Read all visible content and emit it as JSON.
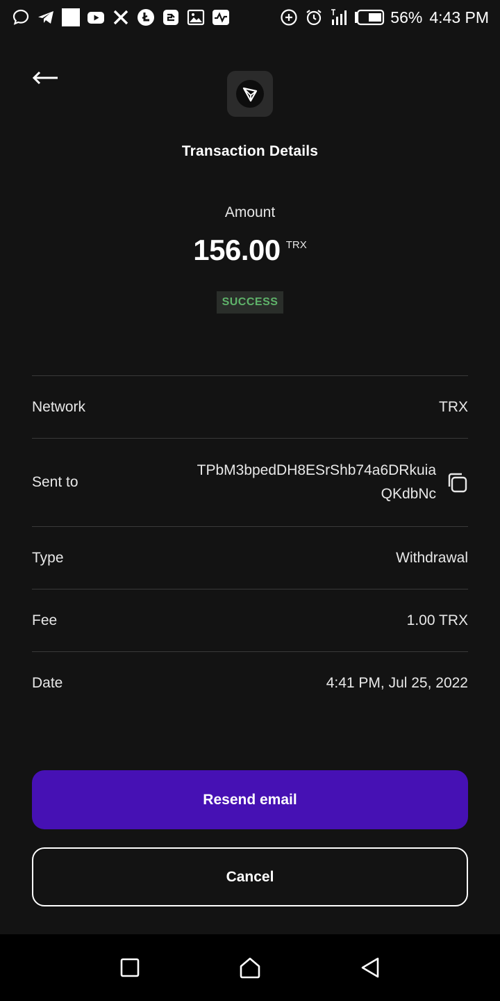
{
  "status_bar": {
    "battery_percent": "56%",
    "time": "4:43 PM",
    "notification_icons": [
      "chat-bubble-icon",
      "telegram-icon",
      "blank-square-icon",
      "youtube-icon",
      "x-icon",
      "litecoin-icon",
      "app-icon",
      "gallery-icon",
      "activity-icon"
    ],
    "system_icons": [
      "data-saver-icon",
      "alarm-icon",
      "signal-icon",
      "battery-icon"
    ]
  },
  "header": {
    "back_icon": "arrow-left-icon",
    "coin_icon": "tron-icon",
    "title": "Transaction Details"
  },
  "amount": {
    "label": "Amount",
    "value": "156.00",
    "unit": "TRX",
    "status": "SUCCESS",
    "status_color": "#5fb36a"
  },
  "details": {
    "network": {
      "label": "Network",
      "value": "TRX"
    },
    "sent_to": {
      "label": "Sent to",
      "value": "TPbM3bpedDH8ESrShb74a6DRkuiaQKdbNc",
      "copy_icon": "copy-icon"
    },
    "type": {
      "label": "Type",
      "value": "Withdrawal"
    },
    "fee": {
      "label": "Fee",
      "value": "1.00 TRX"
    },
    "date": {
      "label": "Date",
      "value": "4:41 PM, Jul 25, 2022"
    }
  },
  "actions": {
    "resend_label": "Resend email",
    "cancel_label": "Cancel",
    "primary_color": "#4611b4"
  },
  "nav_bar": {
    "icons": [
      "recents-icon",
      "home-icon",
      "back-icon"
    ]
  }
}
